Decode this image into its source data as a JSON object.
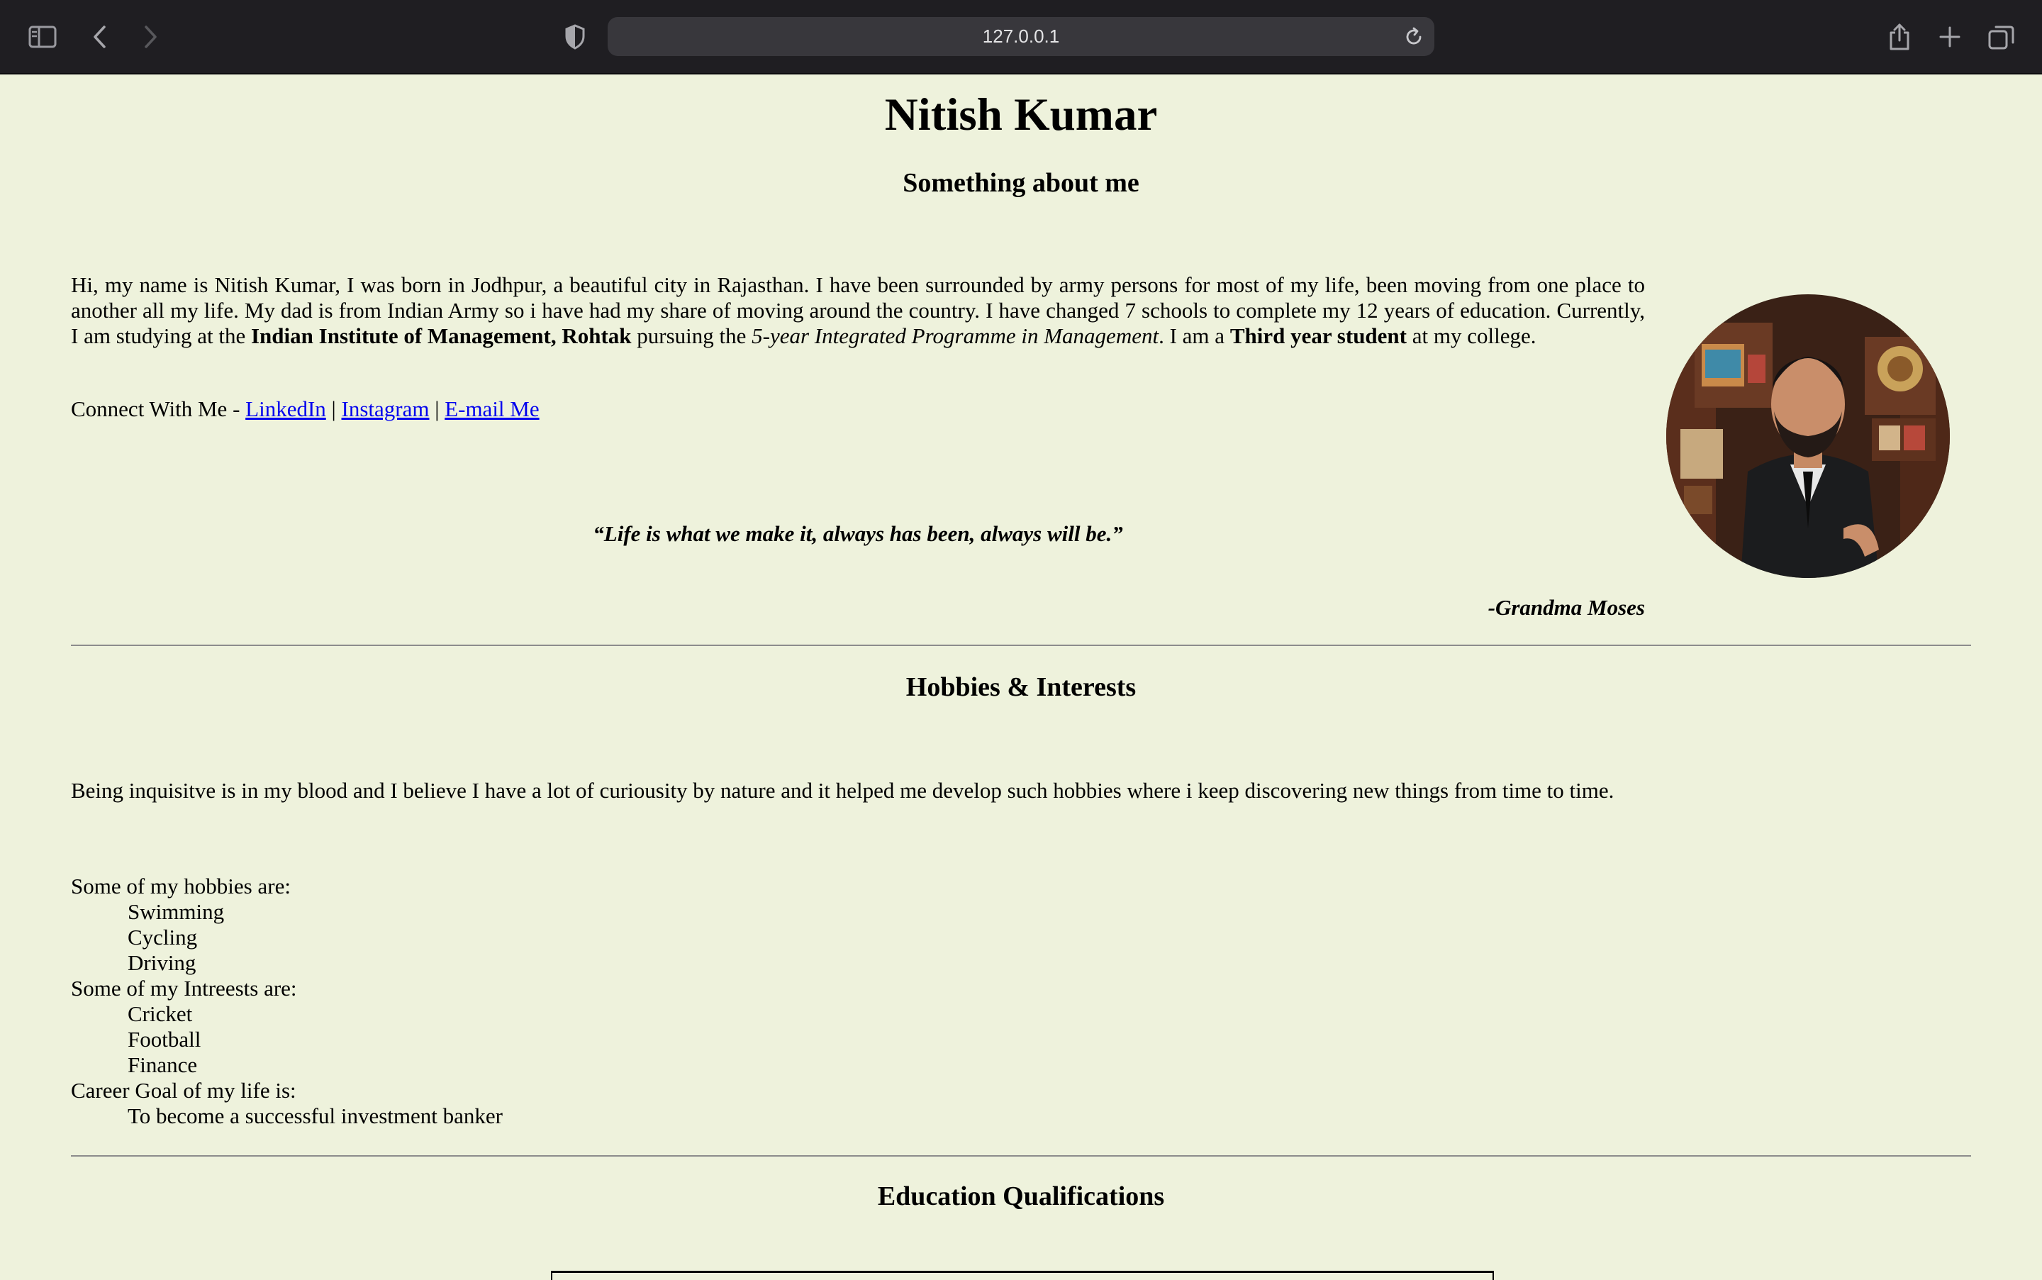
{
  "browser": {
    "url": "127.0.0.1",
    "icons": {
      "sidebar": "sidebar-icon",
      "back": "chevron-left-icon",
      "forward": "chevron-right-icon",
      "privacy": "shield-icon",
      "reload": "reload-icon",
      "share": "share-icon",
      "new_tab": "plus-icon",
      "tabs": "tabs-overview-icon"
    }
  },
  "header": {
    "title": "Nitish Kumar",
    "subtitle": "Something about me"
  },
  "about": {
    "p1": "Hi, my name is Nitish Kumar, I was born in Jodhpur, a beautiful city in Rajasthan. I have been surrounded by army persons for most of my life, been moving from one place to another all my life. My dad is from Indian Army so i have had my share of moving around the country. I have changed 7 schools to complete my 12 years of education. Currently, I am studying at the ",
    "institute": "Indian Institute of Management, Rohtak",
    "p2": " pursuing the ",
    "programme": "5-year Integrated Programme in Management",
    "p3": ". I am a ",
    "year": "Third year student",
    "p4": " at my college."
  },
  "connect": {
    "prefix": "Connect With Me - ",
    "sep": " | ",
    "links": [
      "LinkedIn",
      "Instagram",
      "E-mail Me"
    ]
  },
  "quote": {
    "text": "“Life is what we make it, always has been, always will be.”",
    "author": "-Grandma Moses"
  },
  "hobbies": {
    "heading": "Hobbies & Interests",
    "intro": "Being inquisitve is in my blood and I believe I have a lot of curiousity by nature and it helped me develop such hobbies where i keep discovering new things from time to time.",
    "hobbies_label": "Some of my hobbies are:",
    "hobbies": [
      "Swimming",
      "Cycling",
      "Driving"
    ],
    "interests_label": "Some of my Intreests are:",
    "interests": [
      "Cricket",
      "Football",
      "Finance"
    ],
    "career_label": "Career Goal of my life is:",
    "career": "To become a successful investment banker"
  },
  "education": {
    "heading": "Education Qualifications"
  }
}
